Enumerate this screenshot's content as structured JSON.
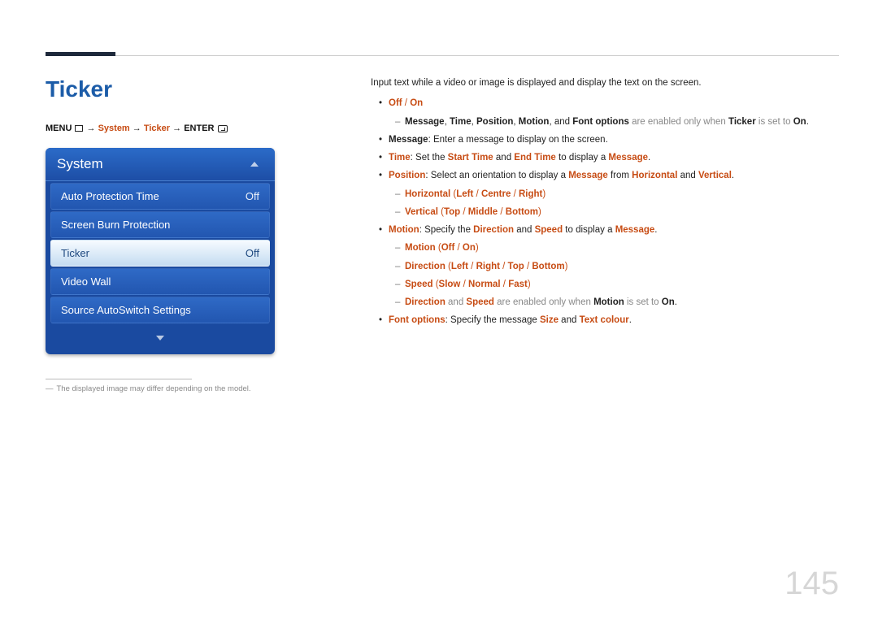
{
  "page_title": "Ticker",
  "breadcrumb": {
    "menu": "MENU",
    "arrow": "→",
    "system": "System",
    "ticker": "Ticker",
    "enter": "ENTER"
  },
  "osd": {
    "header": "System",
    "items": [
      {
        "label": "Auto Protection Time",
        "value": "Off",
        "selected": false
      },
      {
        "label": "Screen Burn Protection",
        "value": "",
        "selected": false
      },
      {
        "label": "Ticker",
        "value": "Off",
        "selected": true
      },
      {
        "label": "Video Wall",
        "value": "",
        "selected": false
      },
      {
        "label": "Source AutoSwitch Settings",
        "value": "",
        "selected": false
      }
    ]
  },
  "footnote": "The displayed image may differ depending on the model.",
  "right": {
    "lead": "Input text while a video or image is displayed and display the text on the screen.",
    "off_on": {
      "off": "Off",
      "on": "On",
      "sep": " / "
    },
    "note_enabled": {
      "pre": "",
      "m": "Message",
      "t": "Time",
      "p": "Position",
      "mo": "Motion",
      "and": ", and ",
      "fo": "Font options",
      "mid": " are enabled only when ",
      "tk": "Ticker",
      "suf": " is set to ",
      "on": "On",
      "dot": "."
    },
    "msg": {
      "lbl": "Message",
      "txt": ": Enter a message to display on the screen."
    },
    "time": {
      "lbl": "Time",
      "pre": ": Set the ",
      "start": "Start Time",
      "and": " and ",
      "end": "End Time",
      "mid": " to display a ",
      "m": "Message",
      "dot": "."
    },
    "position": {
      "lbl": "Position",
      "pre": ": Select an orientation to display a ",
      "m": "Message",
      "from": " from ",
      "h": "Horizontal",
      "and": " and ",
      "v": "Vertical",
      "dot": "."
    },
    "horiz": {
      "lbl": "Horizontal",
      "lp": " (",
      "l": "Left",
      "s": " / ",
      "c": "Centre",
      "r": "Right",
      "rp": ")"
    },
    "vert": {
      "lbl": "Vertical",
      "lp": " (",
      "t": "Top",
      "s": " / ",
      "m": "Middle",
      "b": "Bottom",
      "rp": ")"
    },
    "motion": {
      "lbl": "Motion",
      "pre": ": Specify the ",
      "d": "Direction",
      "and": " and ",
      "sp": "Speed",
      "mid": " to display a ",
      "m": "Message",
      "dot": "."
    },
    "motion_sub": {
      "lbl": "Motion",
      "lp": " (",
      "off": "Off",
      "s": " / ",
      "on": "On",
      "rp": ")"
    },
    "direction_sub": {
      "lbl": "Direction",
      "lp": " (",
      "l": "Left",
      "s": " / ",
      "r": "Right",
      "t": "Top",
      "b": "Bottom",
      "rp": ")"
    },
    "speed_sub": {
      "lbl": "Speed",
      "lp": " (",
      "sl": "Slow",
      "s": " / ",
      "n": "Normal",
      "f": "Fast",
      "rp": ")"
    },
    "note_dir": {
      "d": "Direction",
      "and": " and ",
      "sp": "Speed",
      "mid": " are enabled only when ",
      "mo": "Motion",
      "suf": " is set to ",
      "on": "On",
      "dot": "."
    },
    "font": {
      "lbl": "Font options",
      "pre": ": Specify the message ",
      "sz": "Size",
      "and": " and ",
      "tc": "Text colour",
      "dot": "."
    }
  },
  "page_num": "145"
}
